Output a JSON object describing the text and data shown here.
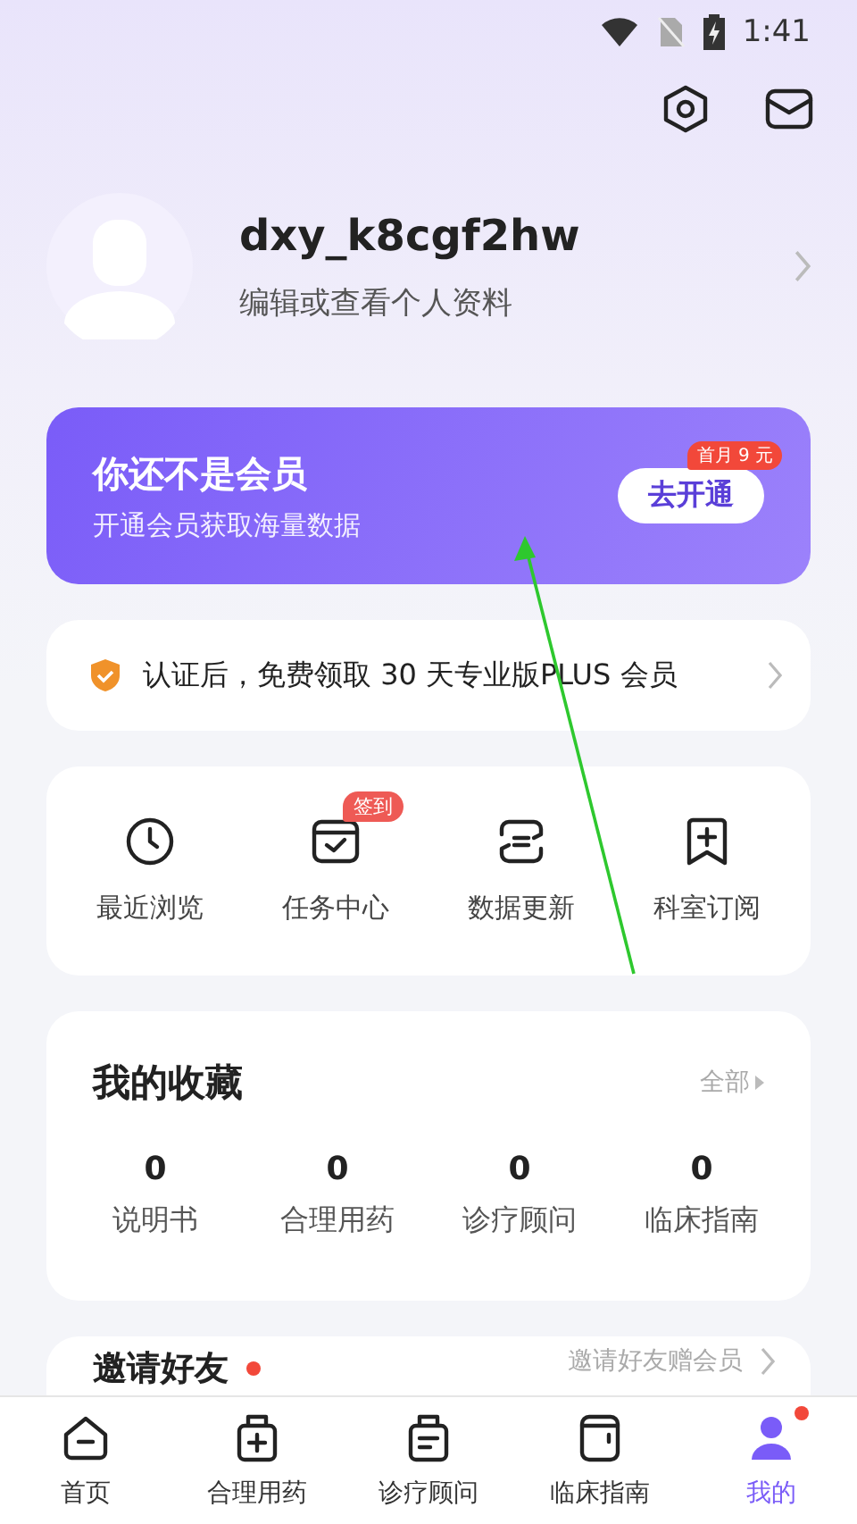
{
  "status_bar": {
    "time": "1:41"
  },
  "profile": {
    "username": "dxy_k8cgf2hw",
    "subtitle": "编辑或查看个人资料"
  },
  "membership": {
    "title": "你还不是会员",
    "subtitle": "开通会员获取海量数据",
    "button": "去开通",
    "badge": "首月 9 元"
  },
  "certification": {
    "text": "认证后，免费领取 30 天专业版PLUS 会员"
  },
  "shortcuts": [
    {
      "label": "最近浏览",
      "kind": "clock"
    },
    {
      "label": "任务中心",
      "kind": "calendar",
      "badge": "签到"
    },
    {
      "label": "数据更新",
      "kind": "update"
    },
    {
      "label": "科室订阅",
      "kind": "bookmark"
    }
  ],
  "favorites": {
    "title": "我的收藏",
    "more": "全部",
    "items": [
      {
        "count": "0",
        "label": "说明书"
      },
      {
        "count": "0",
        "label": "合理用药"
      },
      {
        "count": "0",
        "label": "诊疗顾问"
      },
      {
        "count": "0",
        "label": "临床指南"
      }
    ]
  },
  "invite": {
    "title": "邀请好友",
    "dot": true,
    "link": "邀请好友赠会员"
  },
  "nav": [
    {
      "label": "首页",
      "kind": "home",
      "selected": false,
      "dot": false
    },
    {
      "label": "合理用药",
      "kind": "medicine",
      "selected": false,
      "dot": false
    },
    {
      "label": "诊疗顾问",
      "kind": "consult",
      "selected": false,
      "dot": false
    },
    {
      "label": "临床指南",
      "kind": "guide",
      "selected": false,
      "dot": false
    },
    {
      "label": "我的",
      "kind": "person",
      "selected": true,
      "dot": true
    }
  ]
}
